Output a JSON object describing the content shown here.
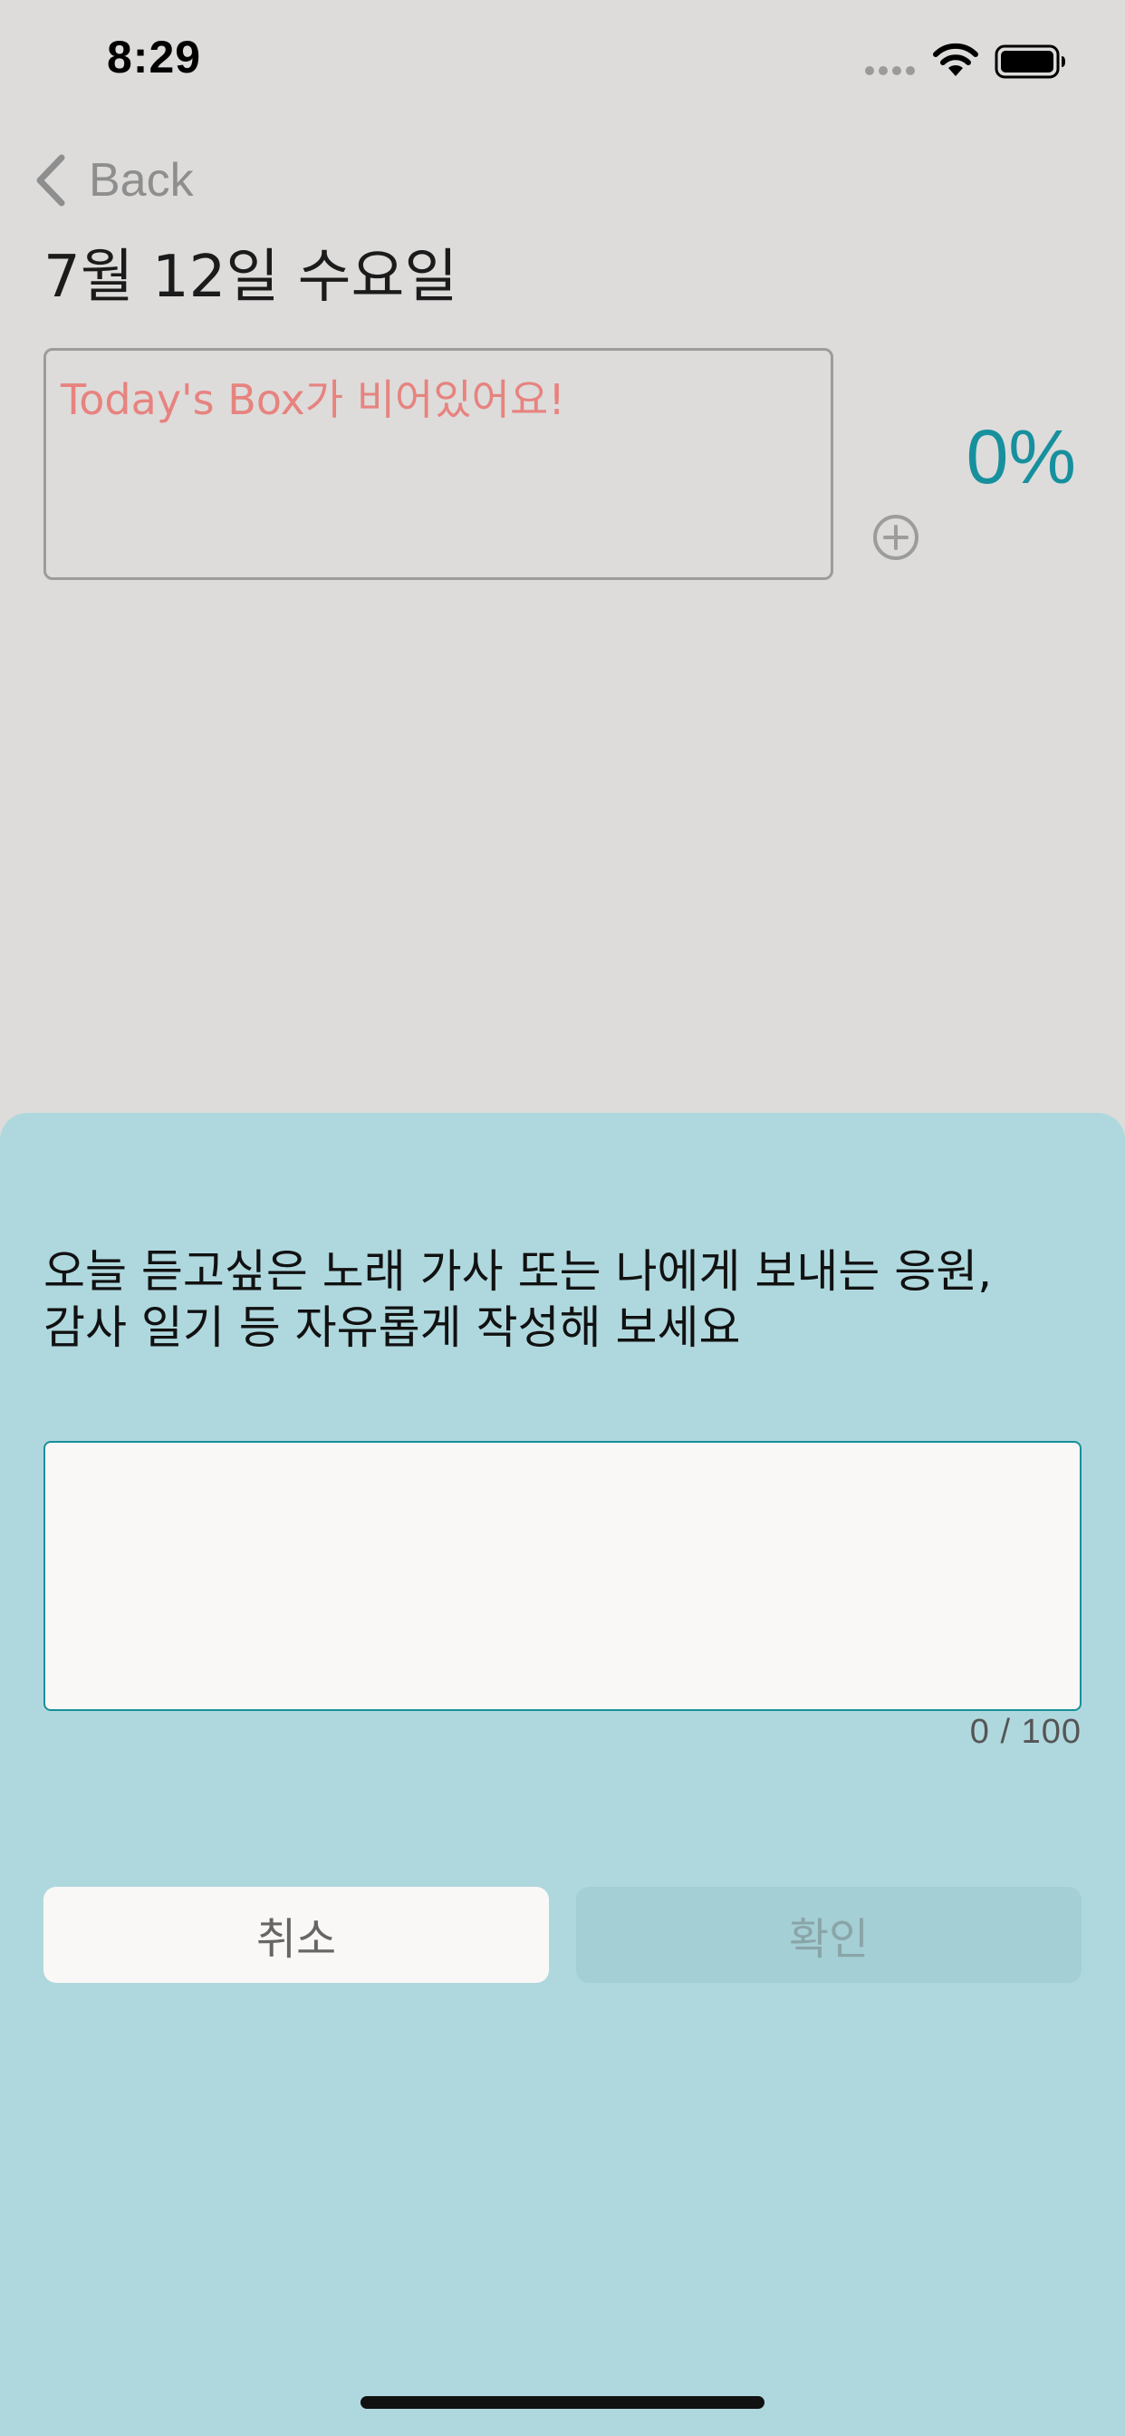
{
  "status_bar": {
    "time": "8:29"
  },
  "nav": {
    "back_label": "Back"
  },
  "header": {
    "date_title": "7월 12일 수요일"
  },
  "today_box": {
    "empty_message": "Today's Box가 비어있어요!",
    "progress_percent": "0%",
    "add_icon": "plus-circle"
  },
  "sheet": {
    "prompt_line1": "오늘 듣고싶은 노래 가사 또는 나에게 보내는 응원,",
    "prompt_line2": "감사 일기 등 자유롭게 작성해 보세요",
    "input_value": "",
    "char_count": "0 / 100",
    "cancel_label": "취소",
    "confirm_label": "확인"
  },
  "colors": {
    "background": "#dddcdb",
    "sheet_background": "#afd8de",
    "accent": "#17909e",
    "empty_message": "#e7837f",
    "confirm_disabled": "#a4cfd4"
  }
}
